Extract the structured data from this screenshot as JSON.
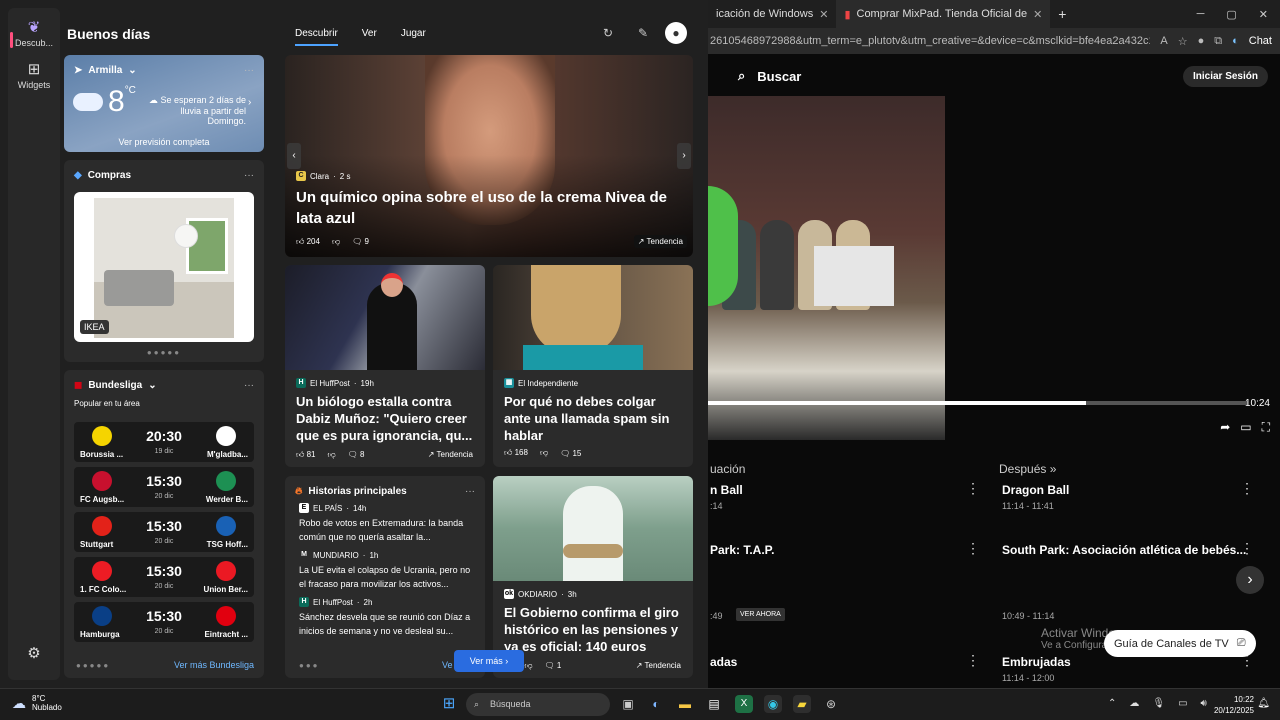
{
  "browser": {
    "tabs": [
      {
        "label": "icación de Windows"
      },
      {
        "label": "Comprar MixPad. Tienda Oficial de"
      }
    ],
    "url": "26105468972988&utm_term=e_plutotv&utm_creative=&device=c&msclkid=bfe4ea2a432c1...",
    "chat_label": "Chat",
    "site": {
      "search_label": "Buscar",
      "login_label": "Iniciar Sesión"
    },
    "video": {
      "progress": 0.7,
      "time": "10:24"
    },
    "schedule": {
      "header_now": "uación",
      "header_next": "Después",
      "rows": [
        {
          "now_title": "n Ball",
          "now_time": ":14",
          "next_title": "Dragon Ball",
          "next_time": "11:14 - 11:41"
        },
        {
          "now_title": "Park: T.A.P.",
          "now_time": ":49",
          "now_badge": "VER AHORA",
          "next_title": "South Park: Asociación atlética de bebés...",
          "next_time": "10:49 - 11:14"
        },
        {
          "now_title": "adas",
          "now_time": "",
          "next_title": "Embrujadas",
          "next_time": "11:14 - 12:00"
        }
      ]
    },
    "guide_label": "Guía de Canales de TV",
    "watermark": {
      "title": "Activar Windows",
      "subtitle": "Ve a Configura"
    }
  },
  "widgets": {
    "rail": [
      {
        "label": "Descub..."
      },
      {
        "label": "Widgets"
      }
    ],
    "greeting": "Buenos días",
    "tabs": [
      {
        "label": "Descubrir"
      },
      {
        "label": "Ver"
      },
      {
        "label": "Jugar"
      }
    ],
    "weather": {
      "location": "Armilla",
      "temp": "8",
      "unit": "°C",
      "desc": "Se esperan 2 días de lluvia a partir del Domingo.",
      "link": "Ver previsión completa"
    },
    "shopping": {
      "title": "Compras",
      "brand": "IKEA"
    },
    "bundesliga": {
      "title": "Bundesliga",
      "subtitle": "Popular en tu área",
      "link": "Ver más Bundesliga",
      "matches": [
        {
          "home": "Borussia ...",
          "away": "M'gladba...",
          "time": "20:30",
          "date": "19 dic",
          "home_color": "#f5d400",
          "away_color": "#ffffff"
        },
        {
          "home": "FC Augsb...",
          "away": "Werder B...",
          "time": "15:30",
          "date": "20 dic",
          "home_color": "#c8102e",
          "away_color": "#1d9053"
        },
        {
          "home": "Stuttgart",
          "away": "TSG Hoff...",
          "time": "15:30",
          "date": "20 dic",
          "home_color": "#e32219",
          "away_color": "#1961b5"
        },
        {
          "home": "1. FC Colo...",
          "away": "Union Ber...",
          "time": "15:30",
          "date": "20 dic",
          "home_color": "#ed1c24",
          "away_color": "#eb1923"
        },
        {
          "home": "Hamburga",
          "away": "Eintracht ...",
          "time": "15:30",
          "date": "20 dic",
          "home_color": "#0a3f86",
          "away_color": "#e1000f"
        }
      ]
    },
    "hero": {
      "source": "Clara",
      "age": "2 s",
      "title": "Un químico opina sobre el uso de la crema Nivea de lata azul",
      "likes": "204",
      "comments": "9",
      "trend": "Tendencia"
    },
    "news": [
      {
        "source": "El HuffPost",
        "age": "19h",
        "title": "Un biólogo estalla contra Dabiz Muñoz: \"Quiero creer que es pura ignorancia, qu...",
        "likes": "81",
        "comments": "8",
        "trend": "Tendencia"
      },
      {
        "source": "El Independiente",
        "title": "Por qué no debes colgar ante una llamada spam sin hablar",
        "likes": "168",
        "comments": "15"
      },
      {
        "source": "OKDIARIO",
        "age": "3h",
        "title": "El Gobierno confirma el giro histórico en las pensiones y ya es oficial: 140 euros más...",
        "comments": "1",
        "trend": "Tendencia"
      }
    ],
    "stories": {
      "title": "Historias principales",
      "items": [
        {
          "source": "EL PAÍS",
          "age": "14h",
          "text": "Robo de votos en Extremadura: la banda común que no quería asaltar la..."
        },
        {
          "source": "MUNDIARIO",
          "age": "1h",
          "text": "La UE evita el colapso de Ucrania, pero no el fracaso para movilizar los activos..."
        },
        {
          "source": "El HuffPost",
          "age": "2h",
          "text": "Sánchez desvela que se reunió con Díaz a inicios de semana y no ve desleal su..."
        }
      ],
      "link_partial": "Ve"
    },
    "see_more": "Ver más"
  },
  "taskbar": {
    "weather_temp": "8°C",
    "weather_desc": "Nublado",
    "search_label": "Búsqueda",
    "time": "10:22",
    "date": "20/12/2025"
  }
}
